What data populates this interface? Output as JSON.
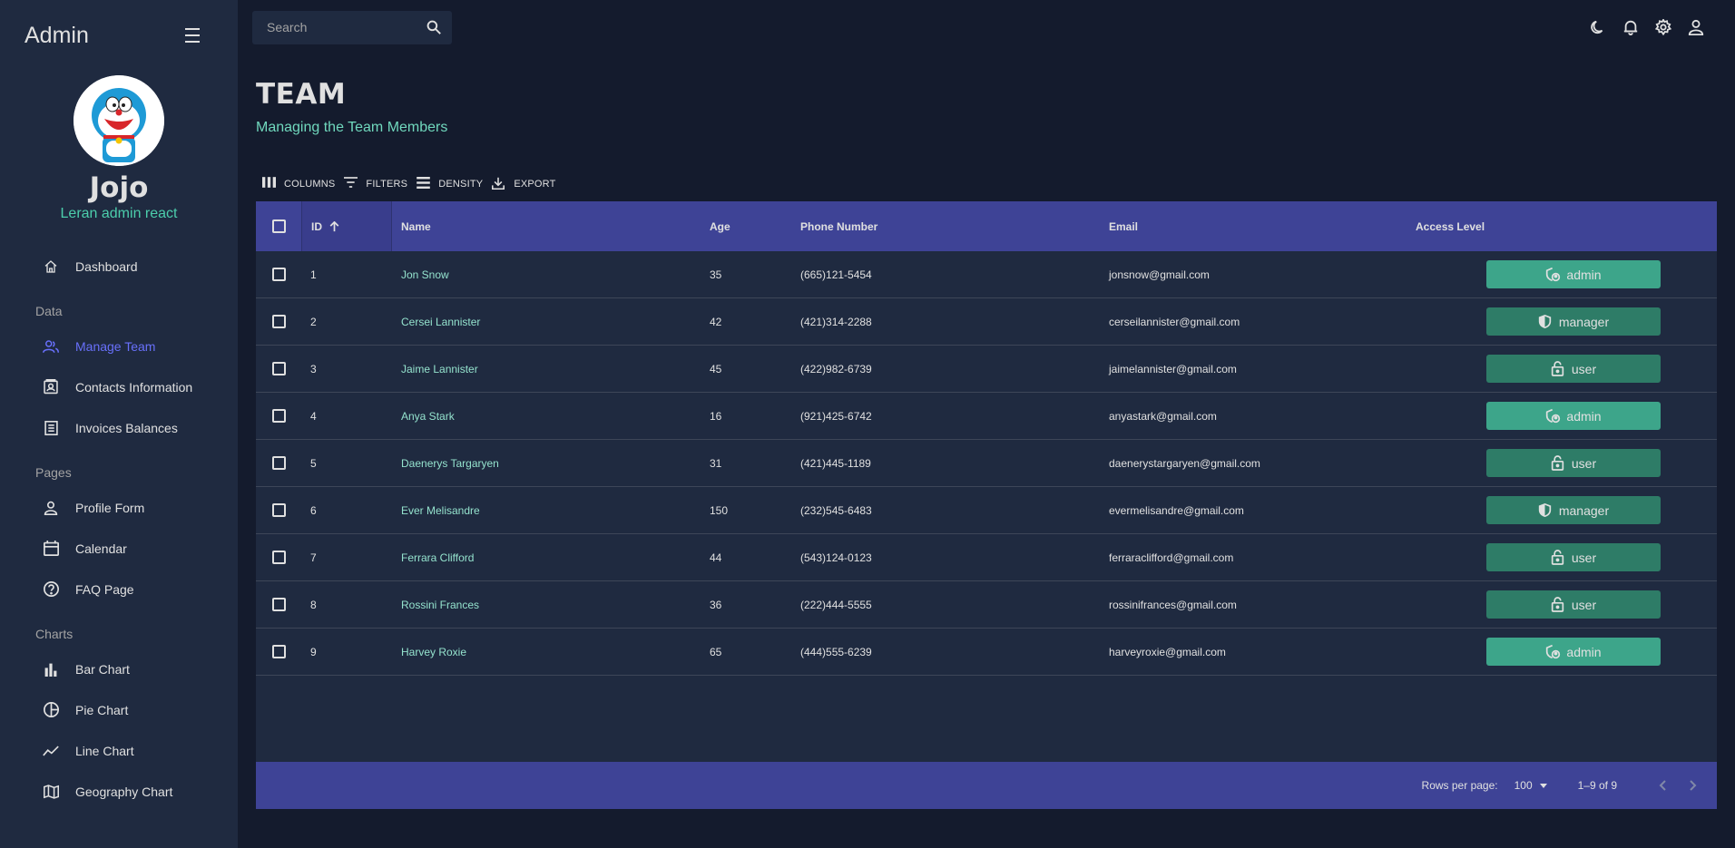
{
  "sidebar": {
    "title": "Admin",
    "profile": {
      "name": "Jojo",
      "role": "Leran admin react"
    },
    "items": [
      {
        "type": "item",
        "label": "Dashboard",
        "icon": "home-icon"
      },
      {
        "type": "section",
        "label": "Data"
      },
      {
        "type": "item",
        "label": "Manage Team",
        "icon": "people-icon",
        "active": true
      },
      {
        "type": "item",
        "label": "Contacts Information",
        "icon": "contacts-icon"
      },
      {
        "type": "item",
        "label": "Invoices Balances",
        "icon": "receipt-icon"
      },
      {
        "type": "section",
        "label": "Pages"
      },
      {
        "type": "item",
        "label": "Profile Form",
        "icon": "person-icon"
      },
      {
        "type": "item",
        "label": "Calendar",
        "icon": "calendar-icon"
      },
      {
        "type": "item",
        "label": "FAQ Page",
        "icon": "help-icon"
      },
      {
        "type": "section",
        "label": "Charts"
      },
      {
        "type": "item",
        "label": "Bar Chart",
        "icon": "bar-chart-icon"
      },
      {
        "type": "item",
        "label": "Pie Chart",
        "icon": "pie-chart-icon"
      },
      {
        "type": "item",
        "label": "Line Chart",
        "icon": "line-chart-icon"
      },
      {
        "type": "item",
        "label": "Geography Chart",
        "icon": "map-icon"
      }
    ]
  },
  "topbar": {
    "search_placeholder": "Search",
    "icons": [
      "dark-mode-icon",
      "notifications-icon",
      "settings-icon",
      "user-icon"
    ]
  },
  "header": {
    "title": "TEAM",
    "subtitle": "Managing the Team Members"
  },
  "toolbar": {
    "columns": "COLUMNS",
    "filters": "FILTERS",
    "density": "DENSITY",
    "export": "EXPORT"
  },
  "table": {
    "headers": {
      "id": "ID",
      "name": "Name",
      "age": "Age",
      "phone": "Phone Number",
      "email": "Email",
      "access": "Access Level"
    },
    "rows": [
      {
        "id": "1",
        "name": "Jon Snow",
        "age": "35",
        "phone": "(665)121-5454",
        "email": "jonsnow@gmail.com",
        "access": "admin"
      },
      {
        "id": "2",
        "name": "Cersei Lannister",
        "age": "42",
        "phone": "(421)314-2288",
        "email": "cerseilannister@gmail.com",
        "access": "manager"
      },
      {
        "id": "3",
        "name": "Jaime Lannister",
        "age": "45",
        "phone": "(422)982-6739",
        "email": "jaimelannister@gmail.com",
        "access": "user"
      },
      {
        "id": "4",
        "name": "Anya Stark",
        "age": "16",
        "phone": "(921)425-6742",
        "email": "anyastark@gmail.com",
        "access": "admin"
      },
      {
        "id": "5",
        "name": "Daenerys Targaryen",
        "age": "31",
        "phone": "(421)445-1189",
        "email": "daenerystargaryen@gmail.com",
        "access": "user"
      },
      {
        "id": "6",
        "name": "Ever Melisandre",
        "age": "150",
        "phone": "(232)545-6483",
        "email": "evermelisandre@gmail.com",
        "access": "manager"
      },
      {
        "id": "7",
        "name": "Ferrara Clifford",
        "age": "44",
        "phone": "(543)124-0123",
        "email": "ferraraclifford@gmail.com",
        "access": "user"
      },
      {
        "id": "8",
        "name": "Rossini Frances",
        "age": "36",
        "phone": "(222)444-5555",
        "email": "rossinifrances@gmail.com",
        "access": "user"
      },
      {
        "id": "9",
        "name": "Harvey Roxie",
        "age": "65",
        "phone": "(444)555-6239",
        "email": "harveyroxie@gmail.com",
        "access": "admin"
      }
    ]
  },
  "footer": {
    "rows_per_page_label": "Rows per page:",
    "rows_per_page": "100",
    "range": "1–9 of 9"
  },
  "colors": {
    "sidebar_bg": "#1f2a40",
    "page_bg": "#141b2d",
    "accent": "#6870fa",
    "green_text": "#4cceac",
    "header_bg": "#3e4396",
    "admin_badge": "#3da58a",
    "other_badge": "#2e7c67"
  }
}
